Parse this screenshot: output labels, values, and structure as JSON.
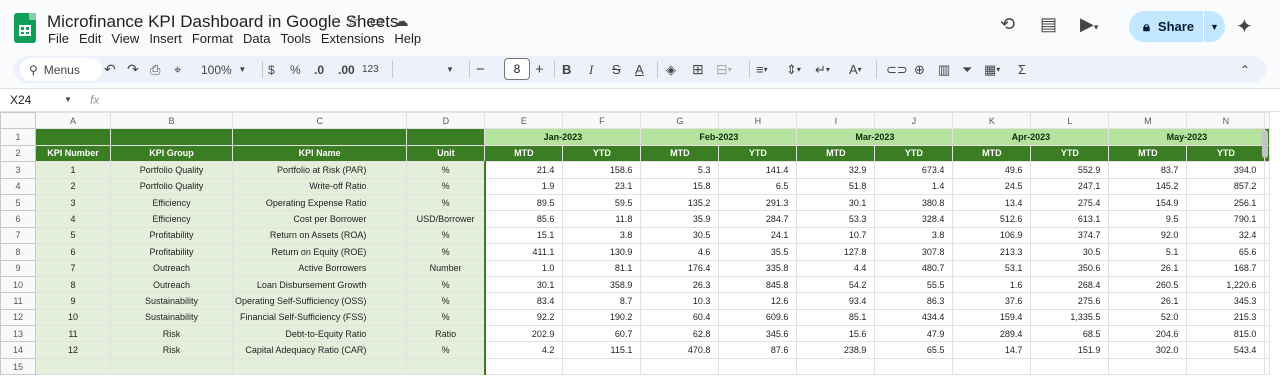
{
  "app": {
    "doc_title": "Microfinance KPI Dashboard in Google Sheets",
    "menu": [
      "File",
      "Edit",
      "View",
      "Insert",
      "Format",
      "Data",
      "Tools",
      "Extensions",
      "Help"
    ],
    "share_label": "Share"
  },
  "toolbar": {
    "menus_label": "Menus",
    "zoom": "100%",
    "currency": "$",
    "percent": "%",
    "dec_dec": ".0",
    "dec_inc": ".00",
    "number_format": "123",
    "font_size": "8",
    "bold": "B",
    "italic": "I",
    "text_color": "A",
    "function": "Σ"
  },
  "formula_bar": {
    "cell_ref": "X24",
    "fx": "fx"
  },
  "columns": [
    "A",
    "B",
    "C",
    "D",
    "E",
    "F",
    "G",
    "H",
    "I",
    "J",
    "K",
    "L",
    "M",
    "N"
  ],
  "months": [
    "Jan-2023",
    "Feb-2023",
    "Mar-2023",
    "Apr-2023",
    "May-2023"
  ],
  "header": {
    "kpi_number": "KPI Number",
    "kpi_group": "KPI Group",
    "kpi_name": "KPI Name",
    "unit": "Unit",
    "mtd": "MTD",
    "ytd": "YTD"
  },
  "rows": [
    {
      "n": "1",
      "group": "Portfolio Quality",
      "name": "Portfolio at Risk (PAR)",
      "unit": "%",
      "vals": [
        "21.4",
        "158.6",
        "5.3",
        "141.4",
        "32.9",
        "673.4",
        "49.6",
        "552.9",
        "83.7",
        "394.0"
      ]
    },
    {
      "n": "2",
      "group": "Portfolio Quality",
      "name": "Write-off Ratio",
      "unit": "%",
      "vals": [
        "1.9",
        "23.1",
        "15.8",
        "6.5",
        "51.8",
        "1.4",
        "24.5",
        "247.1",
        "145.2",
        "857.2"
      ]
    },
    {
      "n": "3",
      "group": "Efficiency",
      "name": "Operating Expense Ratio",
      "unit": "%",
      "vals": [
        "89.5",
        "59.5",
        "135.2",
        "291.3",
        "30.1",
        "380.8",
        "13.4",
        "275.4",
        "154.9",
        "256.1"
      ]
    },
    {
      "n": "4",
      "group": "Efficiency",
      "name": "Cost per Borrower",
      "unit": "USD/Borrower",
      "vals": [
        "85.6",
        "11.8",
        "35.9",
        "284.7",
        "53.3",
        "328.4",
        "512.6",
        "613.1",
        "9.5",
        "790.1"
      ]
    },
    {
      "n": "5",
      "group": "Profitability",
      "name": "Return on Assets (ROA)",
      "unit": "%",
      "vals": [
        "15.1",
        "3.8",
        "30.5",
        "24.1",
        "10.7",
        "3.8",
        "106.9",
        "374.7",
        "92.0",
        "32.4"
      ]
    },
    {
      "n": "6",
      "group": "Profitability",
      "name": "Return on Equity (ROE)",
      "unit": "%",
      "vals": [
        "411.1",
        "130.9",
        "4.6",
        "35.5",
        "127.8",
        "307.8",
        "213.3",
        "30.5",
        "5.1",
        "65.6"
      ]
    },
    {
      "n": "7",
      "group": "Outreach",
      "name": "Active Borrowers",
      "unit": "Number",
      "vals": [
        "1.0",
        "81.1",
        "176.4",
        "335.8",
        "4.4",
        "480.7",
        "53.1",
        "350.6",
        "26.1",
        "168.7"
      ]
    },
    {
      "n": "8",
      "group": "Outreach",
      "name": "Loan Disbursement Growth",
      "unit": "%",
      "vals": [
        "30.1",
        "358.9",
        "26.3",
        "845.8",
        "54.2",
        "55.5",
        "1.6",
        "268.4",
        "260.5",
        "1,220.6"
      ]
    },
    {
      "n": "9",
      "group": "Sustainability",
      "name": "Operating Self-Sufficiency (OSS)",
      "unit": "%",
      "vals": [
        "83.4",
        "8.7",
        "10.3",
        "12.6",
        "93.4",
        "86.3",
        "37.6",
        "275.6",
        "26.1",
        "345.3"
      ]
    },
    {
      "n": "10",
      "group": "Sustainability",
      "name": "Financial Self-Sufficiency (FSS)",
      "unit": "%",
      "vals": [
        "92.2",
        "190.2",
        "60.4",
        "609.6",
        "85.1",
        "434.4",
        "159.4",
        "1,335.5",
        "52.0",
        "215.3"
      ]
    },
    {
      "n": "11",
      "group": "Risk",
      "name": "Debt-to-Equity Ratio",
      "unit": "Ratio",
      "vals": [
        "202.9",
        "60.7",
        "62.8",
        "345.6",
        "15.6",
        "47.9",
        "289.4",
        "68.5",
        "204.6",
        "815.0"
      ]
    },
    {
      "n": "12",
      "group": "Risk",
      "name": "Capital Adequacy Ratio (CAR)",
      "unit": "%",
      "vals": [
        "4.2",
        "115.1",
        "470.8",
        "87.6",
        "238.9",
        "65.5",
        "14.7",
        "151.9",
        "302.0",
        "543.4"
      ]
    }
  ],
  "row_numbers": [
    "1",
    "2",
    "3",
    "4",
    "5",
    "6",
    "7",
    "8",
    "9",
    "10",
    "11",
    "12",
    "13",
    "14",
    "15"
  ],
  "colors": {
    "dark_green": "#3a7d22",
    "light_green": "#b5e29d",
    "pale_green": "#e3efda",
    "share_bg": "#c2e7ff"
  }
}
